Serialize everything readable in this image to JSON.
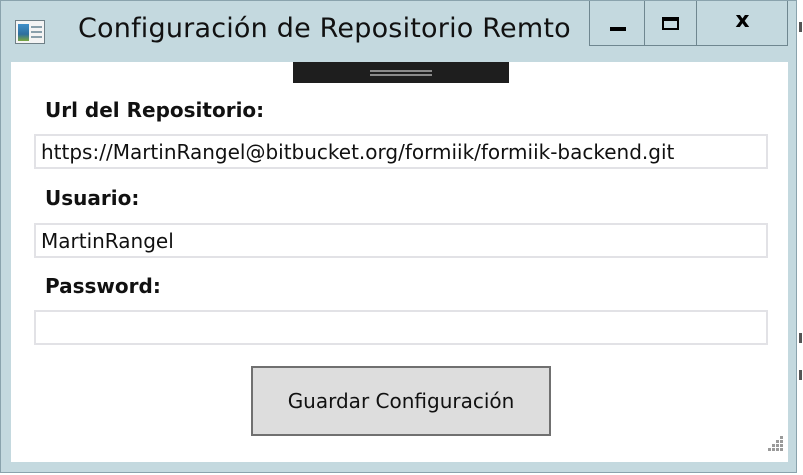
{
  "window": {
    "title": "Configuración de Repositorio Remto",
    "app_icon": "app-window-icon",
    "caption_buttons": {
      "minimize": "minimize-icon",
      "maximize": "maximize-icon",
      "close_glyph": "x"
    }
  },
  "form": {
    "url_label": "Url del Repositorio:",
    "url_value": "https://MartinRangel@bitbucket.org/formiik/formiik-backend.git",
    "user_label": "Usuario:",
    "user_value": "MartinRangel",
    "password_label": "Password:",
    "password_value": "",
    "save_label": "Guardar Configuración"
  },
  "colors": {
    "titlebar": "#c4d9df",
    "client_bg": "#ffffff",
    "button_bg": "#dddddd",
    "grip_bar": "#1e1e1e"
  }
}
